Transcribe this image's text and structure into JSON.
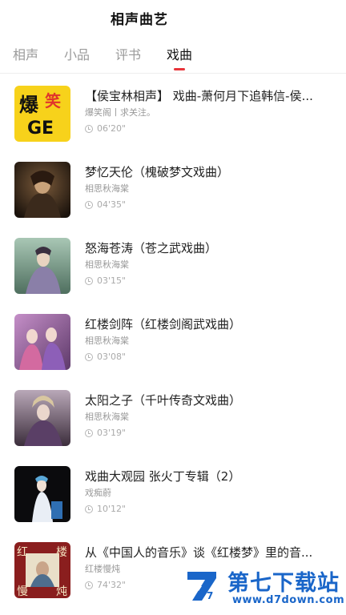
{
  "header": {
    "title": "相声曲艺"
  },
  "tabs": [
    {
      "label": "相声",
      "active": false
    },
    {
      "label": "小品",
      "active": false
    },
    {
      "label": "评书",
      "active": false
    },
    {
      "label": "戏曲",
      "active": true
    }
  ],
  "accent_color": "#e8343a",
  "items": [
    {
      "title": "【侯宝林相声】 戏曲-萧何月下追韩信-侯...",
      "author": "爆笑阁丨求关注。",
      "duration": "06'20\"",
      "thumb_text": [
        "爆",
        "笑",
        "GE"
      ]
    },
    {
      "title": "梦忆天伦（槐破梦文戏曲）",
      "author": "相思秋海棠",
      "duration": "04'35\""
    },
    {
      "title": "怒海苍涛（苍之武戏曲）",
      "author": "相思秋海棠",
      "duration": "03'15\""
    },
    {
      "title": "红楼剑阵（红楼剑阁武戏曲）",
      "author": "相思秋海棠",
      "duration": "03'08\""
    },
    {
      "title": "太阳之子（千叶传奇文戏曲）",
      "author": "相思秋海棠",
      "duration": "03'19\""
    },
    {
      "title": "戏曲大观园 张火丁专辑（2）",
      "author": "戏痴蔚",
      "duration": "10'12\""
    },
    {
      "title": "从《中国人的音乐》谈《红楼梦》里的音...",
      "author": "红楼慢炖",
      "duration": "74'32\"",
      "thumb_text": [
        "红",
        "楼",
        "慢",
        "炖"
      ]
    }
  ],
  "watermark": {
    "name": "第七下载站",
    "url": "www.d7down.com",
    "logo_letter": "7"
  }
}
